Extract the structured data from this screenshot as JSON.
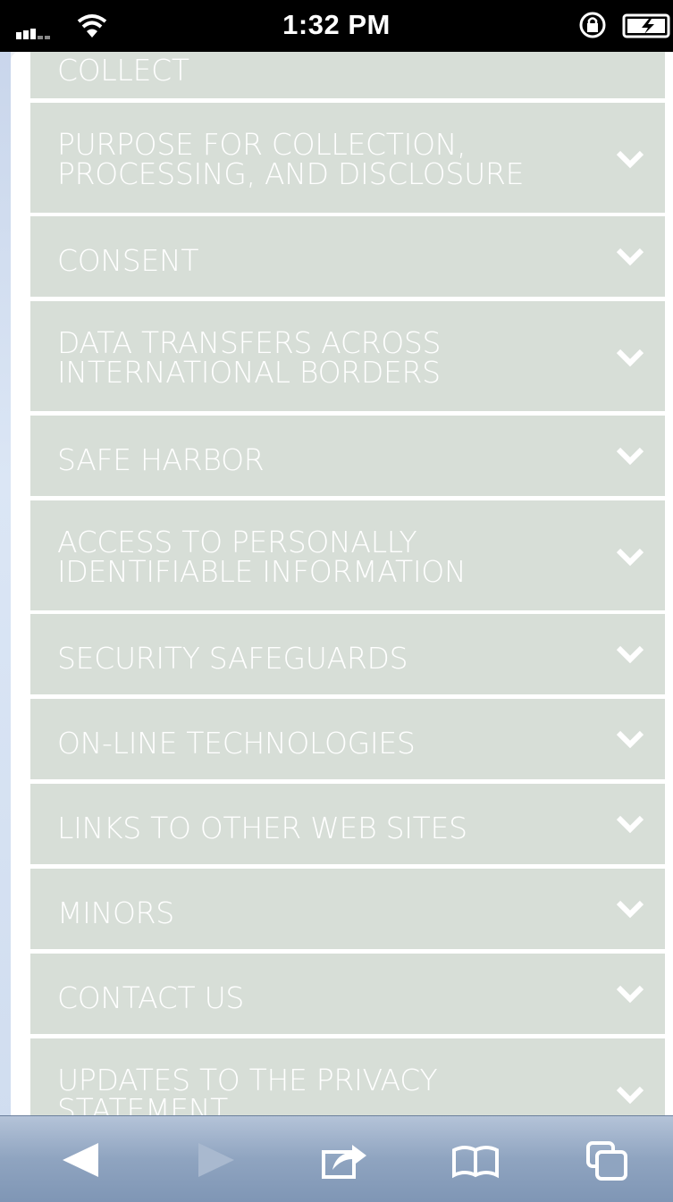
{
  "status_bar": {
    "time": "1:32 PM",
    "icons": [
      "signal-icon",
      "wifi-icon",
      "rotation-lock-icon",
      "battery-charging-icon"
    ]
  },
  "accordion": {
    "items": [
      {
        "label": "COLLECT"
      },
      {
        "label": "PURPOSE FOR COLLECTION,\nPROCESSING, AND DISCLOSURE"
      },
      {
        "label": "CONSENT"
      },
      {
        "label": "DATA TRANSFERS ACROSS\nINTERNATIONAL BORDERS"
      },
      {
        "label": "SAFE HARBOR"
      },
      {
        "label": "ACCESS TO PERSONALLY\nIDENTIFIABLE INFORMATION"
      },
      {
        "label": "SECURITY SAFEGUARDS"
      },
      {
        "label": "ON-LINE TECHNOLOGIES"
      },
      {
        "label": "LINKS TO OTHER WEB SITES"
      },
      {
        "label": "MINORS"
      },
      {
        "label": "CONTACT US"
      },
      {
        "label": "UPDATES TO THE PRIVACY\nSTATEMENT"
      }
    ],
    "colors": {
      "item_bg": "#d7ded7",
      "text": "#ffffff"
    }
  },
  "toolbar": {
    "buttons": [
      "back-icon",
      "forward-icon",
      "share-icon",
      "bookmarks-icon",
      "tabs-icon"
    ]
  }
}
